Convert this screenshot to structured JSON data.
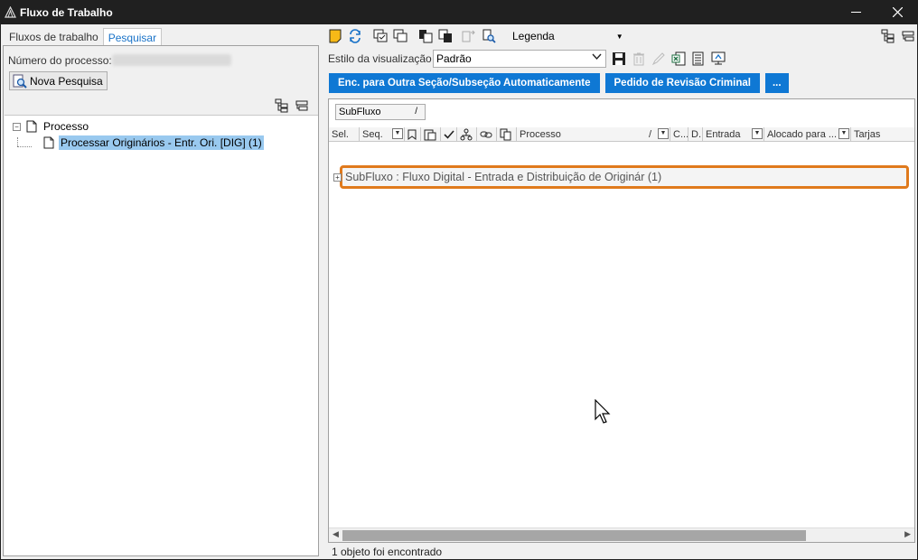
{
  "window": {
    "title": "Fluxo de Trabalho",
    "controls": [
      "minimize",
      "close"
    ]
  },
  "left": {
    "tabs": [
      {
        "label": "Fluxos de trabalho",
        "active": false
      },
      {
        "label": "Pesquisar",
        "active": true
      }
    ],
    "process_number_label": "Número do processo:",
    "new_search_button": "Nova Pesquisa",
    "tree": {
      "root": {
        "label": "Processo",
        "expander": "−"
      },
      "child": {
        "label": "Processar Originários - Entr. Ori. [DIG] (1)",
        "selected": true
      }
    }
  },
  "right": {
    "toolbar": {
      "legend_label": "Legenda"
    },
    "view_style": {
      "label": "Estilo da visualização",
      "selected": "Padrão"
    },
    "actions": [
      {
        "label": "Enc. para Outra Seção/Subseção Automaticamente"
      },
      {
        "label": "Pedido de Revisão Criminal"
      },
      {
        "label": "..."
      }
    ],
    "group_chip": {
      "label": "SubFluxo",
      "sort": "/"
    },
    "columns": [
      {
        "label": "Sel.",
        "width": 34
      },
      {
        "label": "Seq.",
        "width": 50,
        "dropdown": true
      },
      {
        "label": "",
        "width": 18,
        "icon": "bookmark-icon"
      },
      {
        "label": "",
        "width": 22,
        "icon": "clipboard-icon"
      },
      {
        "label": "",
        "width": 18,
        "icon": "check-icon"
      },
      {
        "label": "",
        "width": 22,
        "icon": "tree-icon"
      },
      {
        "label": "",
        "width": 22,
        "icon": "link-icon"
      },
      {
        "label": "",
        "width": 22,
        "icon": "copy-icon"
      },
      {
        "label": "Processo",
        "width": 170,
        "dropdown": true,
        "sort": "/"
      },
      {
        "label": "C...",
        "width": 20
      },
      {
        "label": "D.",
        "width": 16
      },
      {
        "label": "Entrada",
        "width": 68,
        "dropdown": true
      },
      {
        "label": "Alocado para ...",
        "width": 96,
        "dropdown": true
      },
      {
        "label": "Tarjas",
        "width": 40
      }
    ],
    "group_row": {
      "label": "SubFluxo : Fluxo Digital - Entrada e Distribuição de Originár  (1)",
      "expander": "+"
    },
    "status": "1 objeto foi encontrado"
  },
  "colors": {
    "accent": "#0f78d4",
    "highlight": "#e07a1c",
    "selection": "#99c9ef"
  }
}
